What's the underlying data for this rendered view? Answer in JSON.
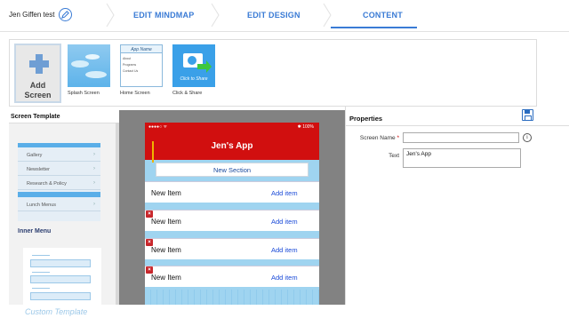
{
  "header": {
    "project_name": "Jen Giffen test",
    "tabs": [
      {
        "label": "EDIT MINDMAP"
      },
      {
        "label": "EDIT DESIGN"
      },
      {
        "label": "CONTENT"
      }
    ],
    "active_tab": "CONTENT",
    "accent_color": "#3a7bd5"
  },
  "screens": {
    "add_label_line1": "Add",
    "add_label_line2": "Screen",
    "items": [
      {
        "caption": "Splash Screen"
      },
      {
        "caption": "Home Screen",
        "thumb_title": "App Name",
        "thumb_rows": [
          "About",
          "Programs",
          "Contact Us"
        ]
      },
      {
        "caption": "Click & Share",
        "thumb_title": "Click to Share"
      }
    ]
  },
  "template_panel": {
    "title": "Screen Template",
    "menu_items": [
      "Gallery",
      "Newsletter",
      "Research & Policy",
      "Lunch Menus"
    ],
    "inner_menu_label": "Inner Menu",
    "custom_label": "Custom Template"
  },
  "preview": {
    "status_carrier": "●●●●○ ᯤ",
    "status_battery": "✱ 100%",
    "app_title": "Jen's App",
    "section_title": "New Section",
    "items": [
      {
        "label": "New Item",
        "add": "Add item"
      },
      {
        "label": "New Item",
        "add": "Add item"
      },
      {
        "label": "New Item",
        "add": "Add item"
      },
      {
        "label": "New Item",
        "add": "Add item"
      }
    ],
    "header_color": "#d10f0f"
  },
  "properties": {
    "title": "Properties",
    "screen_name_label": "Screen Name",
    "screen_name_required": "*",
    "screen_name_value": "",
    "text_label": "Text",
    "text_value": "Jen's App",
    "info_glyph": "i"
  }
}
